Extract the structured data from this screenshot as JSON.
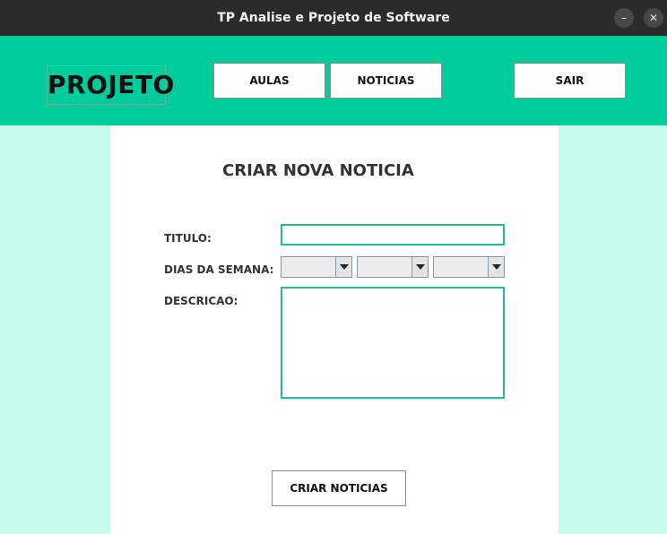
{
  "window": {
    "title": "TP Analise e Projeto de Software",
    "minimize_glyph": "–",
    "close_glyph": "✕"
  },
  "header": {
    "logo": "PROJETO",
    "nav": {
      "aulas": "AULAS",
      "noticias": "NOTICIAS",
      "sair": "SAIR"
    }
  },
  "form": {
    "title": "CRIAR NOVA NOTICIA",
    "titulo_label": "TITULO:",
    "titulo_value": "",
    "dias_label": "DIAS DA SEMANA:",
    "dias_selects": [
      "",
      "",
      ""
    ],
    "descricao_label": "DESCRICAO:",
    "descricao_value": "",
    "submit_label": "CRIAR NOTICIAS"
  },
  "colors": {
    "accent": "#00cc9c",
    "background": "#c4fbea",
    "field_border": "#1fbf95",
    "titlebar": "#2b2b2b"
  }
}
